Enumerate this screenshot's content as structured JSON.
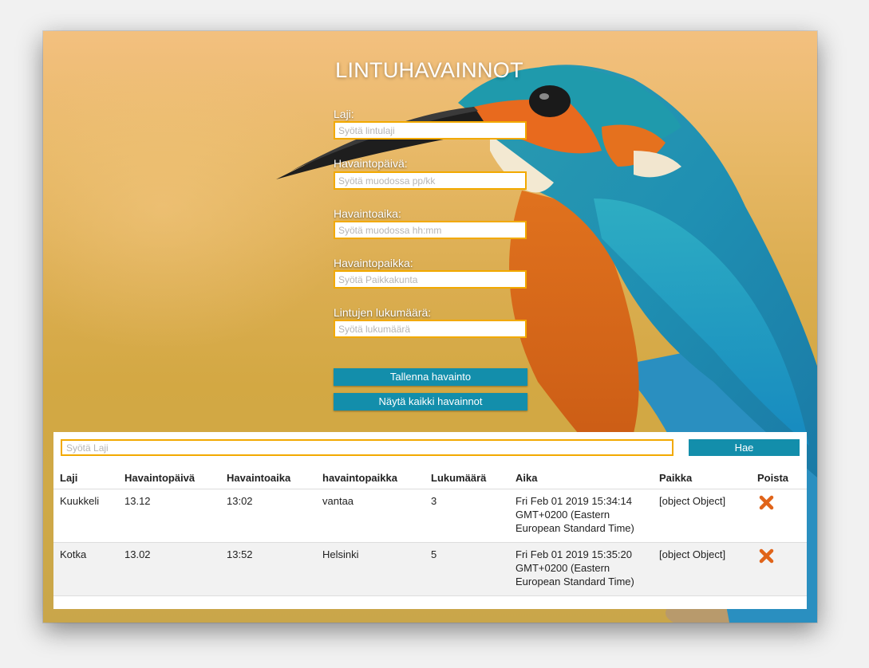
{
  "app": {
    "title": "LINTUHAVAINNOT"
  },
  "form": {
    "fields": [
      {
        "label": "Laji:",
        "placeholder": "Syötä lintulaji",
        "value": ""
      },
      {
        "label": "Havaintopäivä:",
        "placeholder": "Syötä muodossa pp/kk",
        "value": ""
      },
      {
        "label": "Havaintoaika:",
        "placeholder": "Syötä muodossa hh:mm",
        "value": ""
      },
      {
        "label": "Havaintopaikka:",
        "placeholder": "Syötä Paikkakunta",
        "value": ""
      },
      {
        "label": "Lintujen lukumäärä:",
        "placeholder": "Syötä lukumäärä",
        "value": ""
      }
    ],
    "save_label": "Tallenna havainto",
    "show_all_label": "Näytä kaikki havainnot"
  },
  "search": {
    "placeholder": "Syötä Laji",
    "value": "",
    "button_label": "Hae"
  },
  "table": {
    "headers": [
      "Laji",
      "Havaintopäivä",
      "Havaintoaika",
      "havaintopaikka",
      "Lukumäärä",
      "Aika",
      "Paikka",
      "Poista"
    ],
    "rows": [
      {
        "laji": "Kuukkeli",
        "paiva": "13.12",
        "aika": "13:02",
        "paikka": "vantaa",
        "lukumaara": "3",
        "aikaleima": "Fri Feb 01 2019 15:34:14 GMT+0200 (Eastern European Standard Time)",
        "sijainti": "[object Object]",
        "delete_icon": "close-x-icon"
      },
      {
        "laji": "Kotka",
        "paiva": "13.02",
        "aika": "13:52",
        "paikka": "Helsinki",
        "lukumaara": "5",
        "aikaleima": "Fri Feb 01 2019 15:35:20 GMT+0200 (Eastern European Standard Time)",
        "sijainti": "[object Object]",
        "delete_icon": "close-x-icon"
      }
    ]
  },
  "colors": {
    "accent": "#138eab",
    "input_border": "#f2a900",
    "delete_icon": "#e0641a"
  }
}
